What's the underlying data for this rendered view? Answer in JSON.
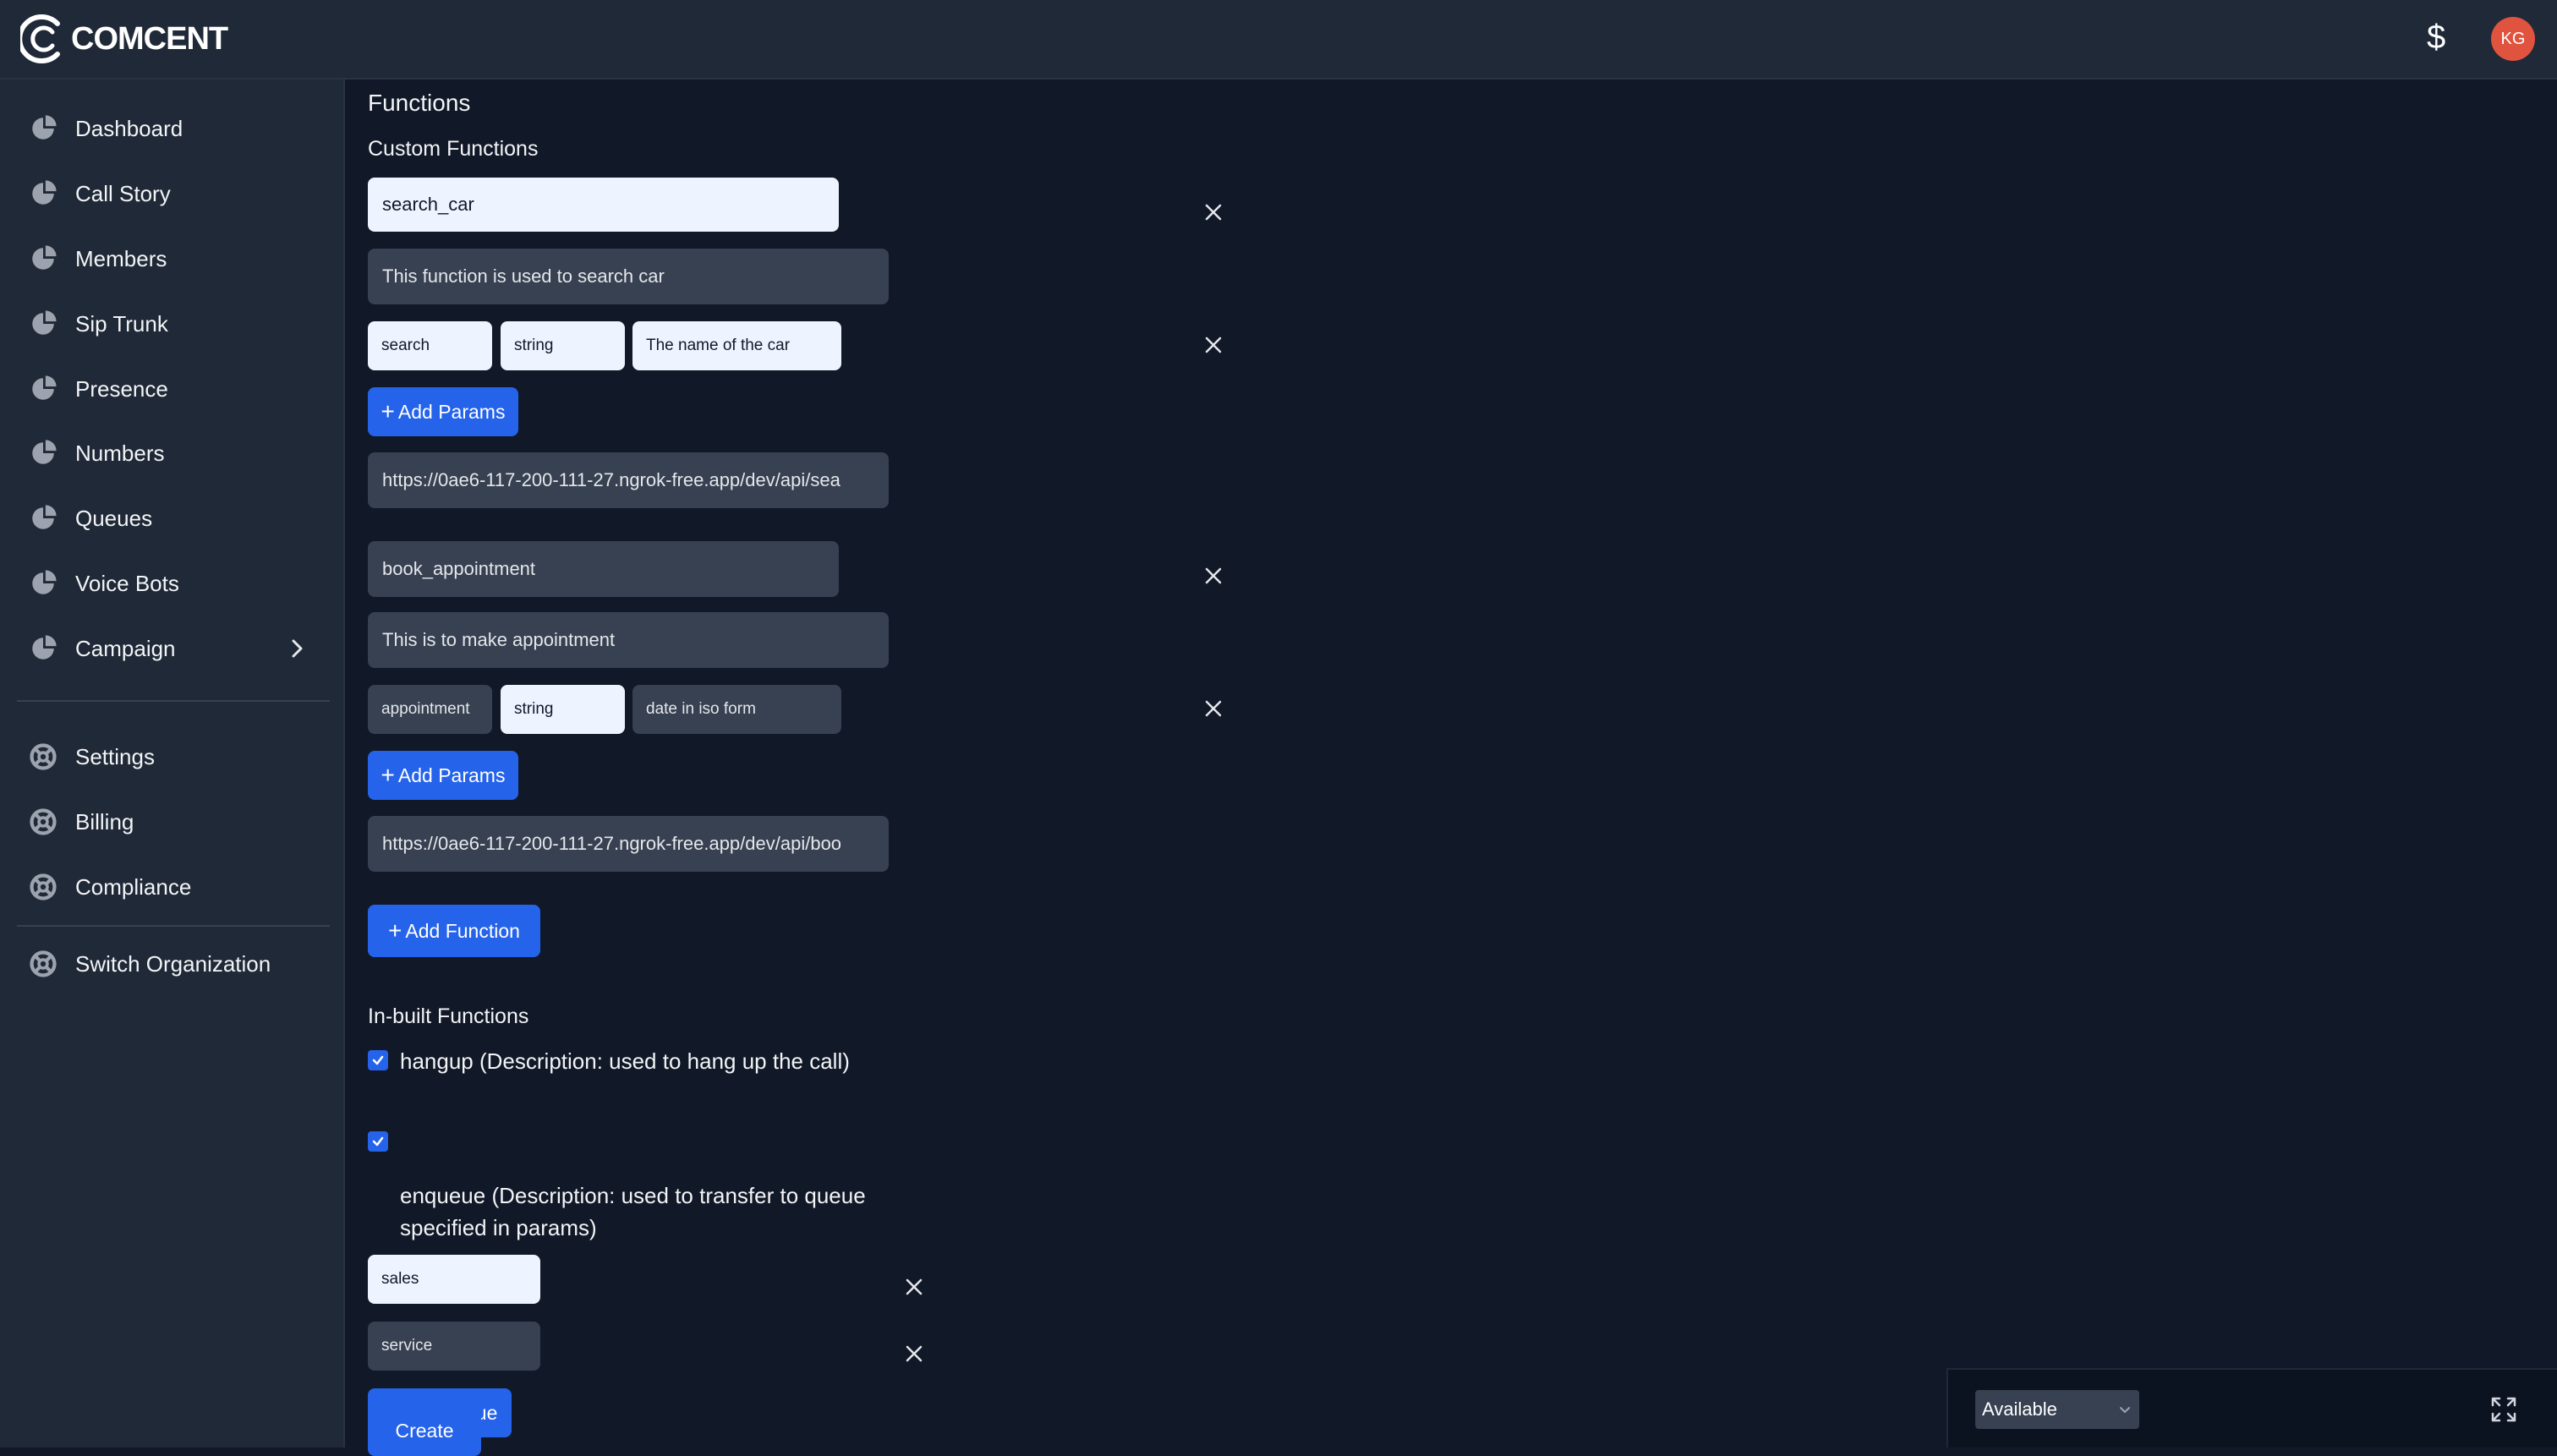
{
  "app": {
    "logo_text": "COMCENT"
  },
  "header": {
    "currency_symbol": "$",
    "avatar_initials": "KG"
  },
  "sidebar": {
    "items": [
      {
        "label": "Dashboard",
        "icon": "pie-chart-icon"
      },
      {
        "label": "Call Story",
        "icon": "pie-chart-icon"
      },
      {
        "label": "Members",
        "icon": "pie-chart-icon"
      },
      {
        "label": "Sip Trunk",
        "icon": "pie-chart-icon"
      },
      {
        "label": "Presence",
        "icon": "pie-chart-icon"
      },
      {
        "label": "Numbers",
        "icon": "pie-chart-icon"
      },
      {
        "label": "Queues",
        "icon": "pie-chart-icon"
      },
      {
        "label": "Voice Bots",
        "icon": "pie-chart-icon"
      },
      {
        "label": "Campaign",
        "icon": "pie-chart-icon"
      }
    ],
    "settings_items": [
      {
        "label": "Settings",
        "icon": "support-icon"
      },
      {
        "label": "Billing",
        "icon": "support-icon"
      },
      {
        "label": "Compliance",
        "icon": "support-icon"
      }
    ],
    "switch_org": {
      "label": "Switch Organization",
      "icon": "support-icon"
    }
  },
  "main": {
    "title": "Functions",
    "custom_title": "Custom Functions",
    "functions": [
      {
        "name": "search_car",
        "description": "This function is used to search car",
        "params": [
          {
            "name": "search",
            "type": "string",
            "description": "The name of the car"
          }
        ],
        "add_params_label": "Add Params",
        "url": "https://0ae6-117-200-111-27.ngrok-free.app/dev/api/sea"
      },
      {
        "name": "book_appointment",
        "description": "This is to make appointment",
        "params": [
          {
            "name": "appointment",
            "type": "string",
            "description": "date in iso form"
          }
        ],
        "add_params_label": "Add Params",
        "url": "https://0ae6-117-200-111-27.ngrok-free.app/dev/api/boo"
      }
    ],
    "add_function_label": "Add Function",
    "inbuilt_title": "In-built Functions",
    "inbuilt": [
      {
        "label": "hangup (Description: used to hang up the call)",
        "checked": true
      },
      {
        "label_line1": "enqueue (Description: used to transfer to queue",
        "label_line2": "specified in params)",
        "checked": true
      }
    ],
    "queues": [
      "sales",
      "service"
    ],
    "add_queue_label": "Add Queue",
    "create_label": "Create"
  },
  "status": {
    "selected": "Available"
  },
  "colors": {
    "accent": "#2563eb",
    "background": "#111827",
    "panel": "#1f2937",
    "avatar": "#e0533f"
  }
}
